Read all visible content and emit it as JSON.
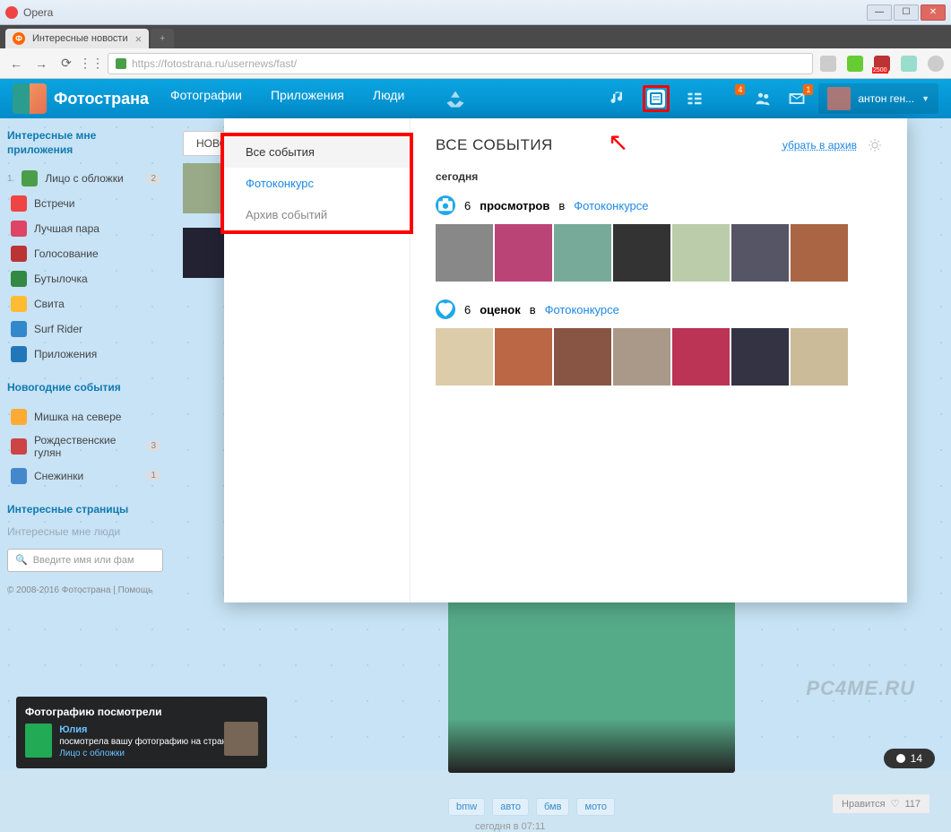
{
  "window": {
    "app": "Opera"
  },
  "tab": {
    "title": "Интересные новости"
  },
  "url": "https://fotostrana.ru/usernews/fast/",
  "logo": "Фотострана",
  "nav": {
    "photos": "Фотографии",
    "apps": "Приложения",
    "people": "Люди"
  },
  "hdrBadges": {
    "b1": "4",
    "b2": "1"
  },
  "user": {
    "name": "антон ген..."
  },
  "sidebar": {
    "title1": "Интересные мне приложения",
    "items1": [
      {
        "label": "Лицо с обложки",
        "count": "2"
      },
      {
        "label": "Встречи"
      },
      {
        "label": "Лучшая пара"
      },
      {
        "label": "Голосование"
      },
      {
        "label": "Бутылочка"
      },
      {
        "label": "Свита"
      },
      {
        "label": "Surf Rider"
      },
      {
        "label": "Приложения"
      }
    ],
    "title2": "Новогодние события",
    "items2": [
      {
        "label": "Мишка на севере"
      },
      {
        "label": "Рождественские гулян",
        "count": "3"
      },
      {
        "label": "Снежинки",
        "count": "1"
      }
    ],
    "title3": "Интересные страницы",
    "title4": "Интересные мне люди",
    "searchPh": "Введите имя или фам",
    "foot": "© 2008-2016 Фотострана | Помощь"
  },
  "newsTab": "НОВО",
  "dropdown": {
    "side": {
      "all": "Все события",
      "contest": "Фотоконкурс",
      "archive": "Архив событий"
    },
    "title": "ВСЕ СОБЫТИЯ",
    "archLink": "убрать в архив",
    "day": "сегодня",
    "event1": {
      "count": "6",
      "word": "просмотров",
      "in": "в",
      "link": "Фотоконкурсе"
    },
    "event2": {
      "count": "6",
      "word": "оценок",
      "in": "в",
      "link": "Фотоконкурсе"
    }
  },
  "post": {
    "tags": [
      "bmw",
      "авто",
      "бмв",
      "мото"
    ],
    "time": "сегодня в 07:11",
    "likes": "Нравится",
    "heartCount": "117"
  },
  "toast": {
    "title": "Фотографию посмотрели",
    "name": "Юлия",
    "text": "посмотрела вашу фотографию на странице",
    "link": "Лицо с обложки"
  },
  "chat": {
    "count": "14"
  },
  "watermark": "PC4ME.RU",
  "ext": {
    "badge": "2500"
  }
}
